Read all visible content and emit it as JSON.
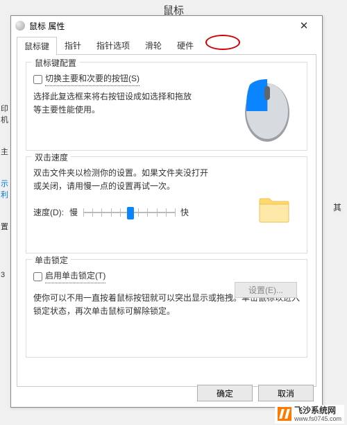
{
  "page": {
    "title": "鼠标"
  },
  "sidebar_left": {
    "items": [
      "印机",
      "主",
      "示利",
      "置",
      "3"
    ]
  },
  "sidebar_right": {
    "hint": "其"
  },
  "dialog": {
    "title": "鼠标 属性",
    "tabs": [
      "鼠标键",
      "指针",
      "指针选项",
      "滑轮",
      "硬件"
    ],
    "active_tab": 0,
    "groups": {
      "config": {
        "title": "鼠标键配置",
        "checkbox_label": "切换主要和次要的按钮(S)",
        "desc": "选择此复选框来将右按钮设成如选择和拖放等主要性能使用。"
      },
      "speed": {
        "title": "双击速度",
        "desc": "双击文件夹以检测你的设置。如果文件夹没打开或关闭，请用慢一点的设置再试一次。",
        "label": "速度(D):",
        "slow": "慢",
        "fast": "快"
      },
      "lock": {
        "title": "单击锁定",
        "checkbox_label": "启用单击锁定(T)",
        "settings_btn": "设置(E)...",
        "desc": "使你可以不用一直按着鼠标按钮就可以突出显示或拖拽。单击鼠标以进入锁定状态，再次单击鼠标可解除锁定。"
      }
    },
    "footer": {
      "ok": "确定",
      "cancel": "取消"
    }
  },
  "watermark": {
    "name": "飞沙系统网",
    "url": "www.fs0745.com"
  }
}
